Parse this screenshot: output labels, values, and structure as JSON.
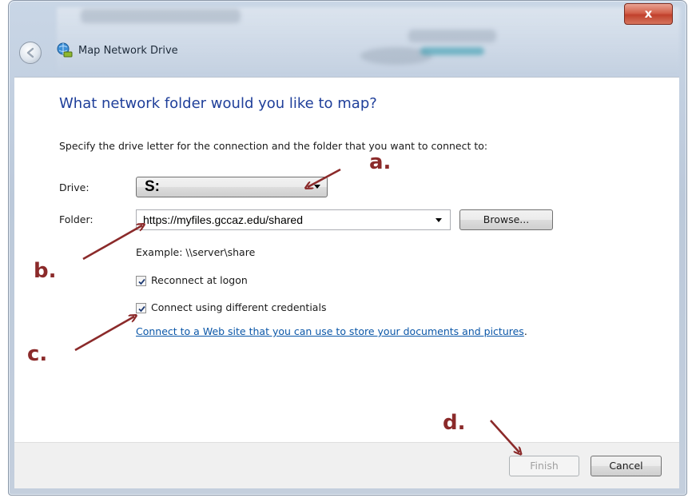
{
  "window": {
    "title": "Map Network Drive",
    "close_glyph": "x"
  },
  "content": {
    "heading": "What network folder would you like to map?",
    "instruction": "Specify the drive letter for the connection and the folder that you want to connect to:",
    "drive_label": "Drive:",
    "drive_value": "S:",
    "folder_label": "Folder:",
    "folder_value": "https://myfiles.gccaz.edu/shared",
    "browse_label": "Browse...",
    "example_text": "Example: \\\\server\\share",
    "reconnect_label": "Reconnect at logon",
    "reconnect_checked": true,
    "credentials_label": "Connect using different credentials",
    "credentials_checked": true,
    "web_link": "Connect to a Web site that you can use to store your documents and pictures",
    "web_link_suffix": "."
  },
  "footer": {
    "finish_label": "Finish",
    "finish_enabled": false,
    "cancel_label": "Cancel"
  },
  "annotations": {
    "a": "a.",
    "b": "b.",
    "c": "c.",
    "d": "d.",
    "color": "#8b2a2a"
  },
  "icons": {
    "back": "back-arrow-icon",
    "title": "network-drive-icon",
    "close": "close-icon",
    "checkbox": "checkmark-icon",
    "dropdown": "chevron-down-icon"
  }
}
